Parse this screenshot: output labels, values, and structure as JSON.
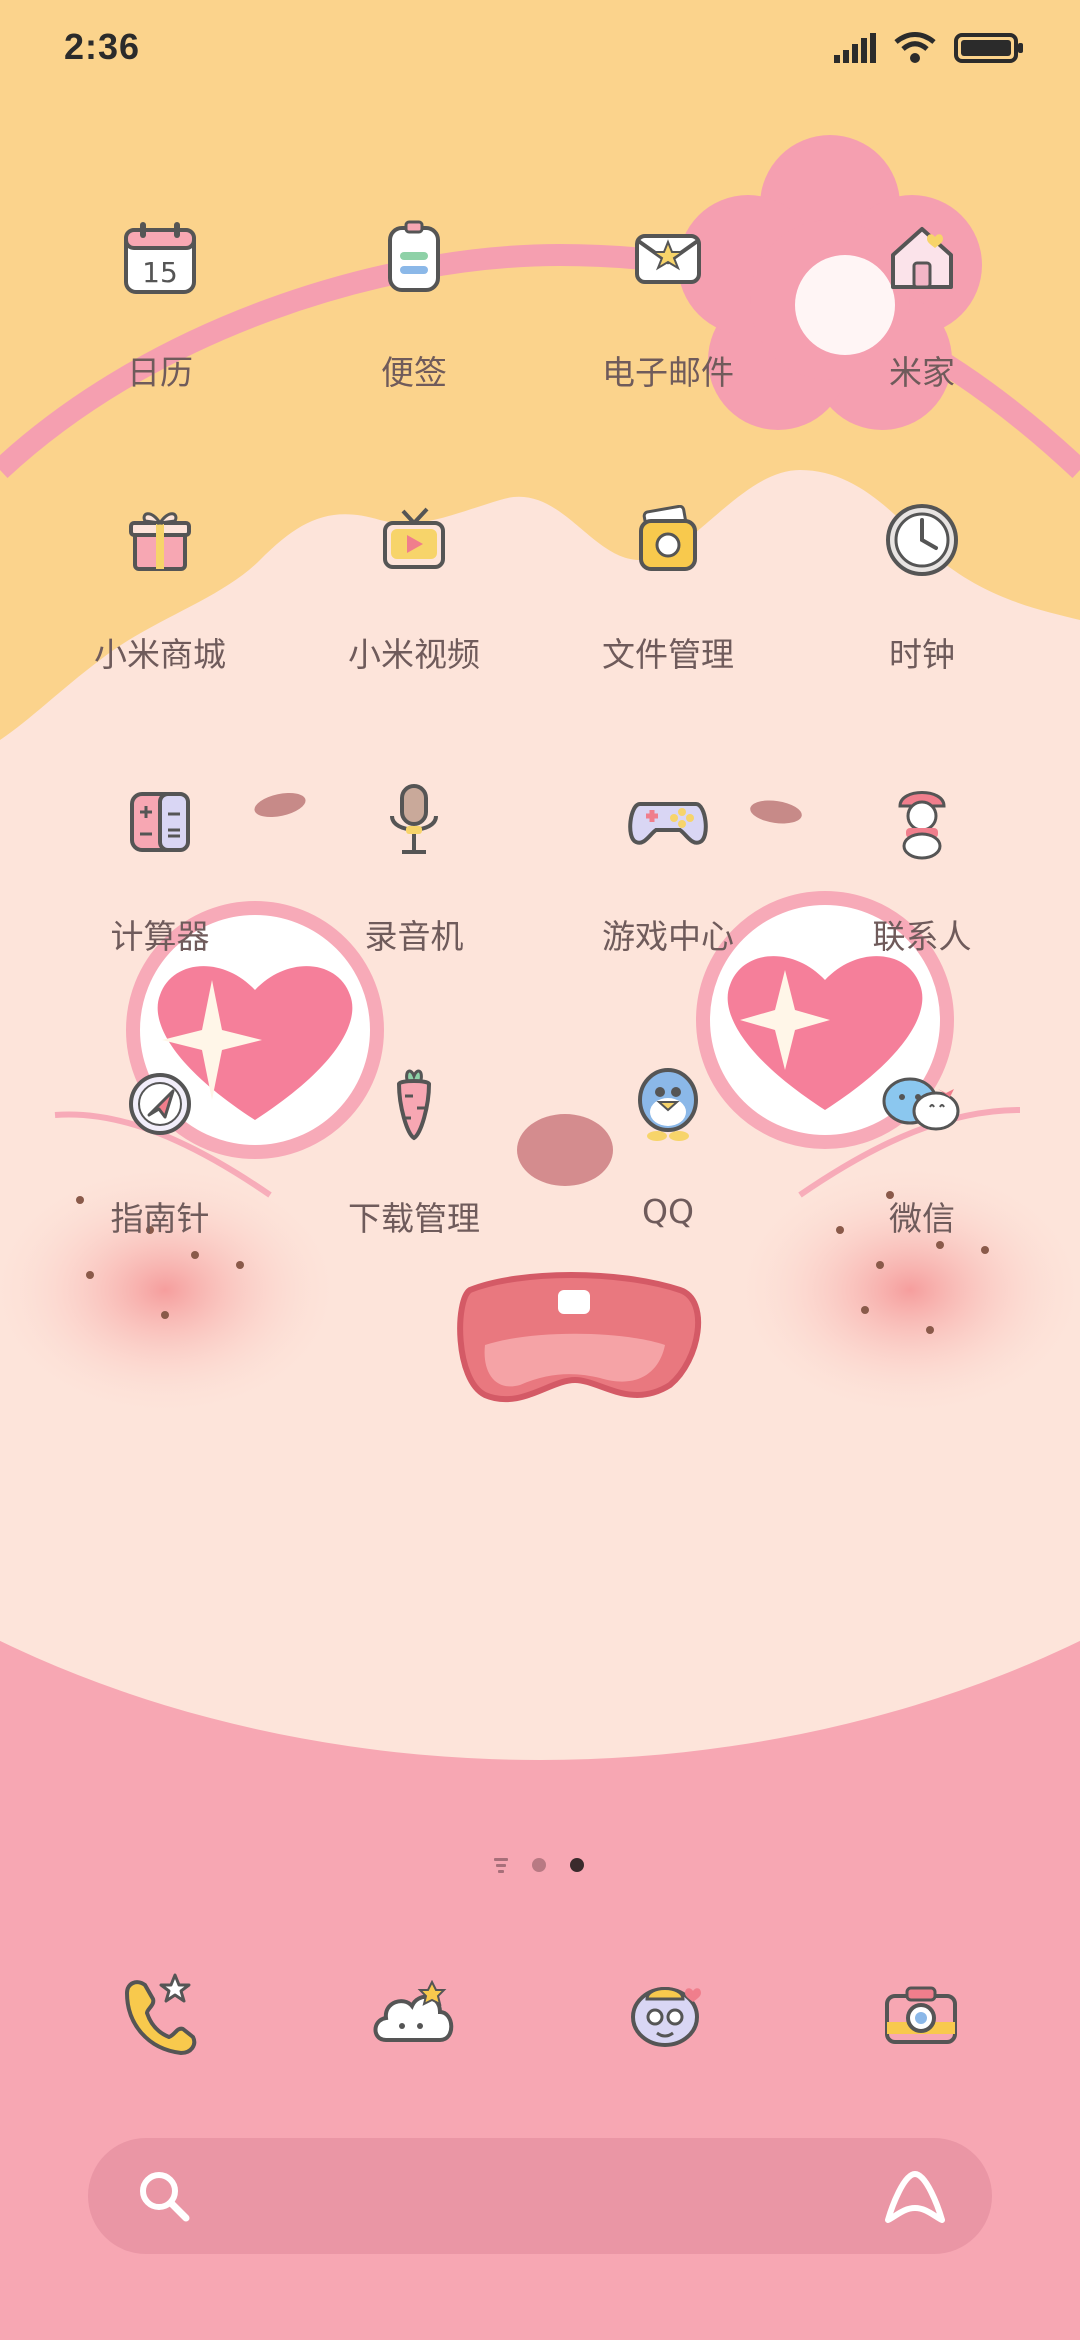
{
  "status_bar": {
    "time": "2:36",
    "icons": [
      "signal-icon",
      "wifi-icon",
      "battery-icon"
    ]
  },
  "apps": [
    {
      "label": "日历",
      "icon": "calendar-icon",
      "icon_text": "15"
    },
    {
      "label": "便签",
      "icon": "notes-icon"
    },
    {
      "label": "电子邮件",
      "icon": "email-icon"
    },
    {
      "label": "米家",
      "icon": "mi-home-icon"
    },
    {
      "label": "小米商城",
      "icon": "mi-store-icon"
    },
    {
      "label": "小米视频",
      "icon": "mi-video-icon"
    },
    {
      "label": "文件管理",
      "icon": "file-manager-icon"
    },
    {
      "label": "时钟",
      "icon": "clock-icon"
    },
    {
      "label": "计算器",
      "icon": "calculator-icon"
    },
    {
      "label": "录音机",
      "icon": "recorder-icon"
    },
    {
      "label": "游戏中心",
      "icon": "game-center-icon"
    },
    {
      "label": "联系人",
      "icon": "contacts-icon"
    },
    {
      "label": "指南针",
      "icon": "compass-icon"
    },
    {
      "label": "下载管理",
      "icon": "downloads-icon"
    },
    {
      "label": "QQ",
      "icon": "qq-icon"
    },
    {
      "label": "微信",
      "icon": "wechat-icon"
    }
  ],
  "page_indicator": {
    "pages": 2,
    "current": 2
  },
  "dock": [
    {
      "icon": "phone-icon"
    },
    {
      "icon": "weather-icon"
    },
    {
      "icon": "messages-icon"
    },
    {
      "icon": "camera-icon"
    }
  ],
  "search_bar": {
    "search_icon": "search-icon",
    "assistant_icon": "assistant-icon"
  },
  "colors": {
    "sky": "#fbd38c",
    "face": "#fde4da",
    "pink": "#f7a7b3",
    "label": "#6f5b5b"
  }
}
